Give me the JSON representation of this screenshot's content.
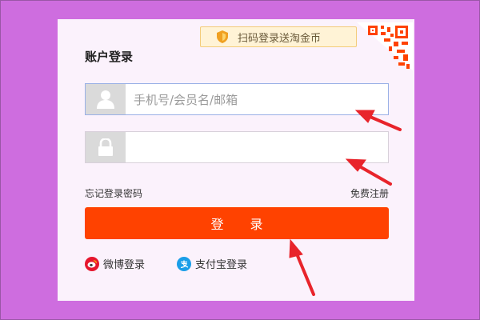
{
  "promo": {
    "text": "扫码登录送淘金币"
  },
  "form": {
    "title": "账户登录",
    "username_placeholder": "手机号/会员名/邮箱",
    "password_placeholder": "",
    "forgot_label": "忘记登录密码",
    "register_label": "免费注册",
    "login_label": "登 录"
  },
  "alt_login": {
    "weibo_label": "微博登录",
    "alipay_label": "支付宝登录"
  },
  "colors": {
    "background": "#ce6ddf",
    "card": "#fbf2fc",
    "login_button": "#ff4200",
    "annotation_arrow": "#e8242b"
  },
  "icons": [
    "shield-icon",
    "qr-code-icon",
    "user-icon",
    "lock-icon",
    "weibo-icon",
    "alipay-icon"
  ]
}
